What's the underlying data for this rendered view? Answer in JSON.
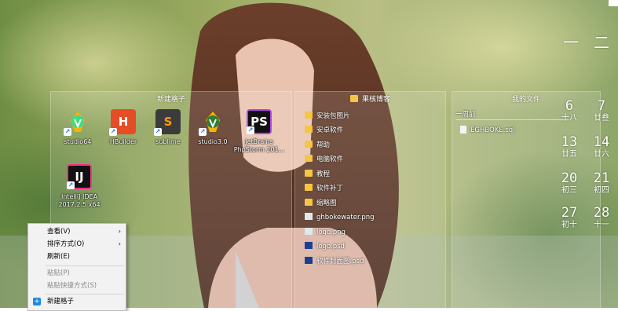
{
  "fences": {
    "new_fence": {
      "title": "新建格子",
      "icons": [
        {
          "label": "studio64",
          "icon": "android-studio-icon"
        },
        {
          "label": "HBuilder",
          "icon": "hbuilder-icon"
        },
        {
          "label": "sublime",
          "icon": "sublime-icon"
        },
        {
          "label": "studio3.0",
          "icon": "android-studio-icon"
        },
        {
          "label": "JetBrains PhpStorm 201...",
          "icon": "phpstorm-icon"
        },
        {
          "label": "IntelliJ IDEA 2017.2.5 x64",
          "icon": "intellij-icon"
        }
      ],
      "glyphs": {
        "hbuilder": "H",
        "sublime": "S",
        "phpstorm": "PS",
        "intellij": "IJ"
      }
    },
    "blog_fence": {
      "title": "果核博客",
      "items": [
        {
          "name": "安装包图片",
          "type": "folder"
        },
        {
          "name": "安卓软件",
          "type": "folder"
        },
        {
          "name": "帮助",
          "type": "folder"
        },
        {
          "name": "电脑软件",
          "type": "folder"
        },
        {
          "name": "教程",
          "type": "folder"
        },
        {
          "name": "软件补丁",
          "type": "folder"
        },
        {
          "name": "缩略图",
          "type": "folder"
        },
        {
          "name": "ghbokewater.png",
          "type": "png"
        },
        {
          "name": "logo.png",
          "type": "png"
        },
        {
          "name": "logo.psd",
          "type": "psd"
        },
        {
          "name": "软件封面图.psd",
          "type": "psd"
        }
      ]
    },
    "my_files": {
      "title": "我的文件",
      "group": "一周前",
      "items": [
        {
          "name": "EGHBOKE.sql",
          "type": "sql"
        }
      ]
    }
  },
  "calendar": {
    "month_left": "一",
    "month_right": "二",
    "cells": [
      {
        "day": "6",
        "lunar": "十八"
      },
      {
        "day": "7",
        "lunar": "廿叁"
      },
      {
        "day": "13",
        "lunar": "廿五"
      },
      {
        "day": "14",
        "lunar": "廿六"
      },
      {
        "day": "20",
        "lunar": "初三"
      },
      {
        "day": "21",
        "lunar": "初四"
      },
      {
        "day": "27",
        "lunar": "初十"
      },
      {
        "day": "28",
        "lunar": "十一"
      }
    ]
  },
  "context_menu": {
    "items": [
      {
        "label": "查看(V)",
        "submenu": true,
        "disabled": false
      },
      {
        "label": "排序方式(O)",
        "submenu": true,
        "disabled": false
      },
      {
        "label": "刷新(E)",
        "submenu": false,
        "disabled": false
      },
      {
        "label": "粘贴(P)",
        "submenu": false,
        "disabled": true
      },
      {
        "label": "粘贴快捷方式(S)",
        "submenu": false,
        "disabled": true
      },
      {
        "label": "新建格子",
        "submenu": false,
        "disabled": false
      }
    ],
    "submenu_glyph": "›",
    "new_fence_glyph": "+"
  },
  "colors": {
    "folder": "#f5c543",
    "psd": "#1c3f95",
    "menu_bg": "#f2f2f2"
  }
}
